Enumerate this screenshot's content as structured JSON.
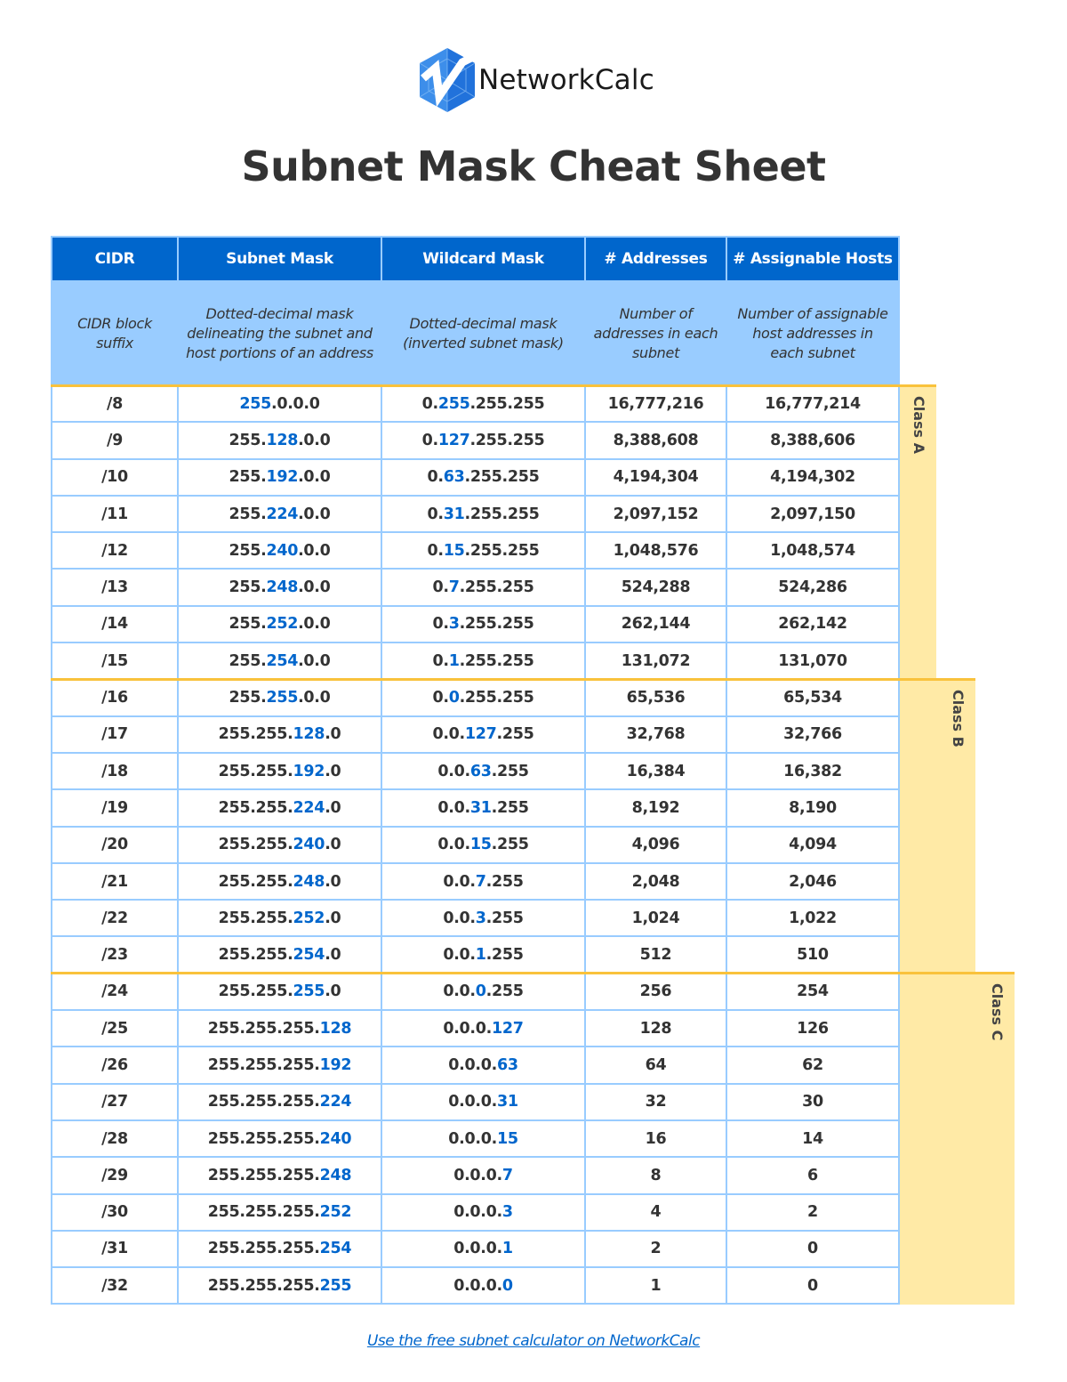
{
  "brand": {
    "logo_icon": "networkcalc-hexagon-logo-icon",
    "name": "NetworkCalc"
  },
  "title": "Subnet Mask Cheat Sheet",
  "colors": {
    "header_dark": "#0066CC",
    "header_light": "#99CCFF",
    "highlight": "#0066CC",
    "class_band": "#FFEAA6",
    "class_separator": "#F9C23C",
    "text": "#333333"
  },
  "table": {
    "headers": [
      {
        "label": "CIDR",
        "description": "CIDR block suffix"
      },
      {
        "label": "Subnet Mask",
        "description": "Dotted-decimal mask delineating the subnet and host portions of an address"
      },
      {
        "label": "Wildcard Mask",
        "description": "Dotted-decimal mask (inverted subnet mask)"
      },
      {
        "label": "# Addresses",
        "description": "Number of addresses in each subnet"
      },
      {
        "label": "# Assignable Hosts",
        "description": "Number of assignable host addresses in each subnet"
      }
    ],
    "rows": [
      {
        "cidr": "/8",
        "mask": [
          "",
          "255",
          ".0.0.0"
        ],
        "wildcard": [
          "0.",
          "255",
          ".255.255"
        ],
        "addresses": "16,777,216",
        "hosts": "16,777,214"
      },
      {
        "cidr": "/9",
        "mask": [
          "255.",
          "128",
          ".0.0"
        ],
        "wildcard": [
          "0.",
          "127",
          ".255.255"
        ],
        "addresses": "8,388,608",
        "hosts": "8,388,606"
      },
      {
        "cidr": "/10",
        "mask": [
          "255.",
          "192",
          ".0.0"
        ],
        "wildcard": [
          "0.",
          "63",
          ".255.255"
        ],
        "addresses": "4,194,304",
        "hosts": "4,194,302"
      },
      {
        "cidr": "/11",
        "mask": [
          "255.",
          "224",
          ".0.0"
        ],
        "wildcard": [
          "0.",
          "31",
          ".255.255"
        ],
        "addresses": "2,097,152",
        "hosts": "2,097,150"
      },
      {
        "cidr": "/12",
        "mask": [
          "255.",
          "240",
          ".0.0"
        ],
        "wildcard": [
          "0.",
          "15",
          ".255.255"
        ],
        "addresses": "1,048,576",
        "hosts": "1,048,574"
      },
      {
        "cidr": "/13",
        "mask": [
          "255.",
          "248",
          ".0.0"
        ],
        "wildcard": [
          "0.",
          "7",
          ".255.255"
        ],
        "addresses": "524,288",
        "hosts": "524,286"
      },
      {
        "cidr": "/14",
        "mask": [
          "255.",
          "252",
          ".0.0"
        ],
        "wildcard": [
          "0.",
          "3",
          ".255.255"
        ],
        "addresses": "262,144",
        "hosts": "262,142"
      },
      {
        "cidr": "/15",
        "mask": [
          "255.",
          "254",
          ".0.0"
        ],
        "wildcard": [
          "0.",
          "1",
          ".255.255"
        ],
        "addresses": "131,072",
        "hosts": "131,070"
      },
      {
        "cidr": "/16",
        "mask": [
          "255.",
          "255",
          ".0.0"
        ],
        "wildcard": [
          "0.",
          "0",
          ".255.255"
        ],
        "addresses": "65,536",
        "hosts": "65,534"
      },
      {
        "cidr": "/17",
        "mask": [
          "255.255.",
          "128",
          ".0"
        ],
        "wildcard": [
          "0.0.",
          "127",
          ".255"
        ],
        "addresses": "32,768",
        "hosts": "32,766"
      },
      {
        "cidr": "/18",
        "mask": [
          "255.255.",
          "192",
          ".0"
        ],
        "wildcard": [
          "0.0.",
          "63",
          ".255"
        ],
        "addresses": "16,384",
        "hosts": "16,382"
      },
      {
        "cidr": "/19",
        "mask": [
          "255.255.",
          "224",
          ".0"
        ],
        "wildcard": [
          "0.0.",
          "31",
          ".255"
        ],
        "addresses": "8,192",
        "hosts": "8,190"
      },
      {
        "cidr": "/20",
        "mask": [
          "255.255.",
          "240",
          ".0"
        ],
        "wildcard": [
          "0.0.",
          "15",
          ".255"
        ],
        "addresses": "4,096",
        "hosts": "4,094"
      },
      {
        "cidr": "/21",
        "mask": [
          "255.255.",
          "248",
          ".0"
        ],
        "wildcard": [
          "0.0.",
          "7",
          ".255"
        ],
        "addresses": "2,048",
        "hosts": "2,046"
      },
      {
        "cidr": "/22",
        "mask": [
          "255.255.",
          "252",
          ".0"
        ],
        "wildcard": [
          "0.0.",
          "3",
          ".255"
        ],
        "addresses": "1,024",
        "hosts": "1,022"
      },
      {
        "cidr": "/23",
        "mask": [
          "255.255.",
          "254",
          ".0"
        ],
        "wildcard": [
          "0.0.",
          "1",
          ".255"
        ],
        "addresses": "512",
        "hosts": "510"
      },
      {
        "cidr": "/24",
        "mask": [
          "255.255.",
          "255",
          ".0"
        ],
        "wildcard": [
          "0.0.",
          "0",
          ".255"
        ],
        "addresses": "256",
        "hosts": "254"
      },
      {
        "cidr": "/25",
        "mask": [
          "255.255.255.",
          "128",
          ""
        ],
        "wildcard": [
          "0.0.0.",
          "127",
          ""
        ],
        "addresses": "128",
        "hosts": "126"
      },
      {
        "cidr": "/26",
        "mask": [
          "255.255.255.",
          "192",
          ""
        ],
        "wildcard": [
          "0.0.0.",
          "63",
          ""
        ],
        "addresses": "64",
        "hosts": "62"
      },
      {
        "cidr": "/27",
        "mask": [
          "255.255.255.",
          "224",
          ""
        ],
        "wildcard": [
          "0.0.0.",
          "31",
          ""
        ],
        "addresses": "32",
        "hosts": "30"
      },
      {
        "cidr": "/28",
        "mask": [
          "255.255.255.",
          "240",
          ""
        ],
        "wildcard": [
          "0.0.0.",
          "15",
          ""
        ],
        "addresses": "16",
        "hosts": "14"
      },
      {
        "cidr": "/29",
        "mask": [
          "255.255.255.",
          "248",
          ""
        ],
        "wildcard": [
          "0.0.0.",
          "7",
          ""
        ],
        "addresses": "8",
        "hosts": "6"
      },
      {
        "cidr": "/30",
        "mask": [
          "255.255.255.",
          "252",
          ""
        ],
        "wildcard": [
          "0.0.0.",
          "3",
          ""
        ],
        "addresses": "4",
        "hosts": "2"
      },
      {
        "cidr": "/31",
        "mask": [
          "255.255.255.",
          "254",
          ""
        ],
        "wildcard": [
          "0.0.0.",
          "1",
          ""
        ],
        "addresses": "2",
        "hosts": "0"
      },
      {
        "cidr": "/32",
        "mask": [
          "255.255.255.",
          "255",
          ""
        ],
        "wildcard": [
          "0.0.0.",
          "0",
          ""
        ],
        "addresses": "1",
        "hosts": "0"
      }
    ]
  },
  "classes": [
    {
      "label": "Class A",
      "range": "/8 – /15"
    },
    {
      "label": "Class B",
      "range": "/16 – /23"
    },
    {
      "label": "Class C",
      "range": "/24 – /32"
    }
  ],
  "footer": {
    "link_text": "Use the free subnet calculator on NetworkCalc"
  }
}
